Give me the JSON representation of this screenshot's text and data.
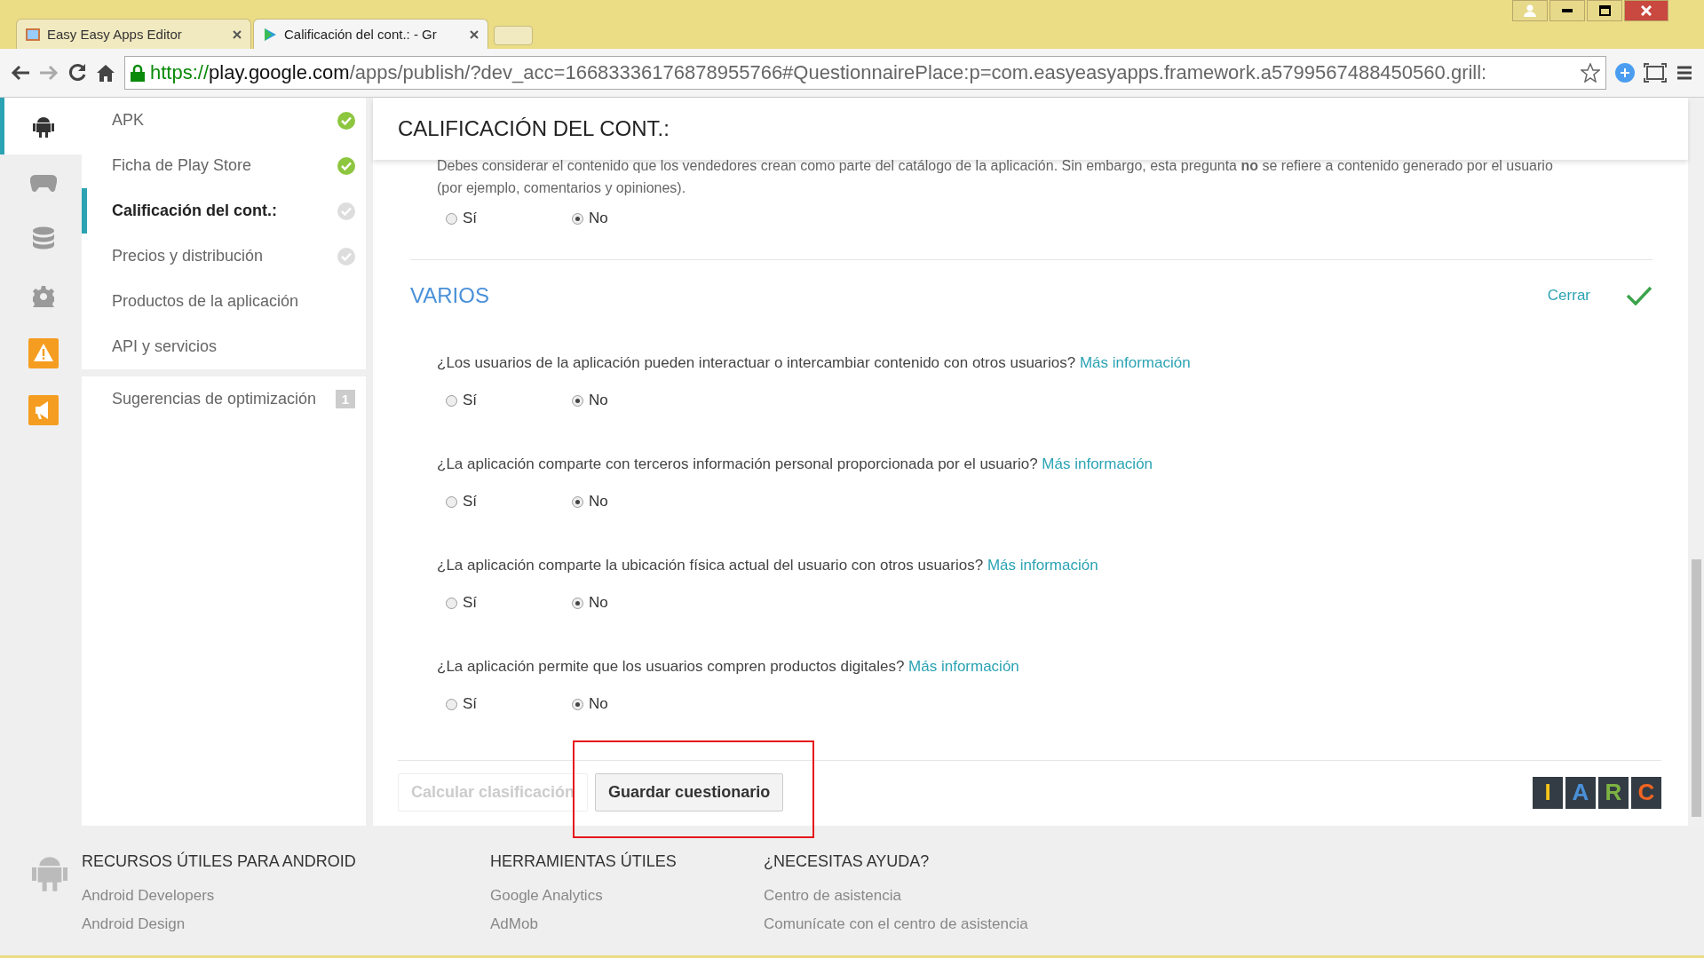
{
  "browser": {
    "tabs": [
      {
        "title": "Easy Easy Apps Editor",
        "selected": false
      },
      {
        "title": "Calificación del cont.: - Gr",
        "selected": true
      }
    ],
    "url": {
      "scheme": "https://",
      "host": "play.google.com",
      "path": "/apps/publish/?dev_acc=16683336176878955766#QuestionnairePlace:p=com.easyeasyapps.framework.a5799567488450560.grill:"
    }
  },
  "rail": {
    "items": [
      {
        "kind": "android",
        "selected": true
      },
      {
        "kind": "gamepad",
        "selected": false
      },
      {
        "kind": "database",
        "selected": false
      },
      {
        "kind": "gear",
        "selected": false
      },
      {
        "kind": "warning",
        "selected": false
      },
      {
        "kind": "megaphone",
        "selected": false
      }
    ]
  },
  "sidebar": {
    "items": [
      {
        "label": "APK",
        "selected": false,
        "complete": true
      },
      {
        "label": "Ficha de Play Store",
        "selected": false,
        "complete": true
      },
      {
        "label": "Calificación del cont.:",
        "selected": true,
        "complete": false
      },
      {
        "label": "Precios y distribución",
        "selected": false,
        "complete": false
      },
      {
        "label": "Productos de la aplicación",
        "selected": false
      },
      {
        "label": "API y servicios",
        "selected": false
      }
    ],
    "extra": {
      "label": "Sugerencias de optimización",
      "badge": "1"
    }
  },
  "page_title": "CALIFICACIÓN DEL CONT.:",
  "intro": {
    "text": "Debes considerar el contenido que los vendedores crean como parte del catálogo de la aplicación. Sin embargo, esta pregunta **no** se refiere a contenido generado por el usuario (por ejemplo, comentarios y opiniones).",
    "options": [
      {
        "label": "Sí",
        "selected": false
      },
      {
        "label": "No",
        "selected": true
      }
    ]
  },
  "section": {
    "title": "VARIOS",
    "close": "Cerrar",
    "complete": true
  },
  "questions": [
    {
      "text": "¿Los usuarios de la aplicación pueden interactuar o intercambiar contenido con otros usuarios?",
      "link": "Más información",
      "options": [
        {
          "label": "Sí",
          "selected": false
        },
        {
          "label": "No",
          "selected": true
        }
      ]
    },
    {
      "text": "¿La aplicación comparte con terceros información personal proporcionada por el usuario?",
      "link": "Más información",
      "options": [
        {
          "label": "Sí",
          "selected": false
        },
        {
          "label": "No",
          "selected": true
        }
      ]
    },
    {
      "text": "¿La aplicación comparte la ubicación física actual del usuario con otros usuarios?",
      "link": "Más información",
      "options": [
        {
          "label": "Sí",
          "selected": false
        },
        {
          "label": "No",
          "selected": true
        }
      ]
    },
    {
      "text": "¿La aplicación permite que los usuarios compren productos digitales?",
      "link": "Más información",
      "options": [
        {
          "label": "Sí",
          "selected": false
        },
        {
          "label": "No",
          "selected": true
        }
      ]
    }
  ],
  "buttons": [
    {
      "label": "Calcular clasificación",
      "disabled": true
    },
    {
      "label": "Guardar cuestionario",
      "disabled": false
    }
  ],
  "iarc": [
    "I",
    "A",
    "R",
    "C"
  ],
  "footer": [
    {
      "heading": "RECURSOS ÚTILES PARA ANDROID",
      "links": [
        "Android Developers",
        "Android Design"
      ]
    },
    {
      "heading": "HERRAMIENTAS ÚTILES",
      "links": [
        "Google Analytics",
        "AdMob"
      ]
    },
    {
      "heading": "¿NECESITAS AYUDA?",
      "links": [
        "Centro de asistencia",
        "Comunícate con el centro de asistencia"
      ]
    }
  ]
}
